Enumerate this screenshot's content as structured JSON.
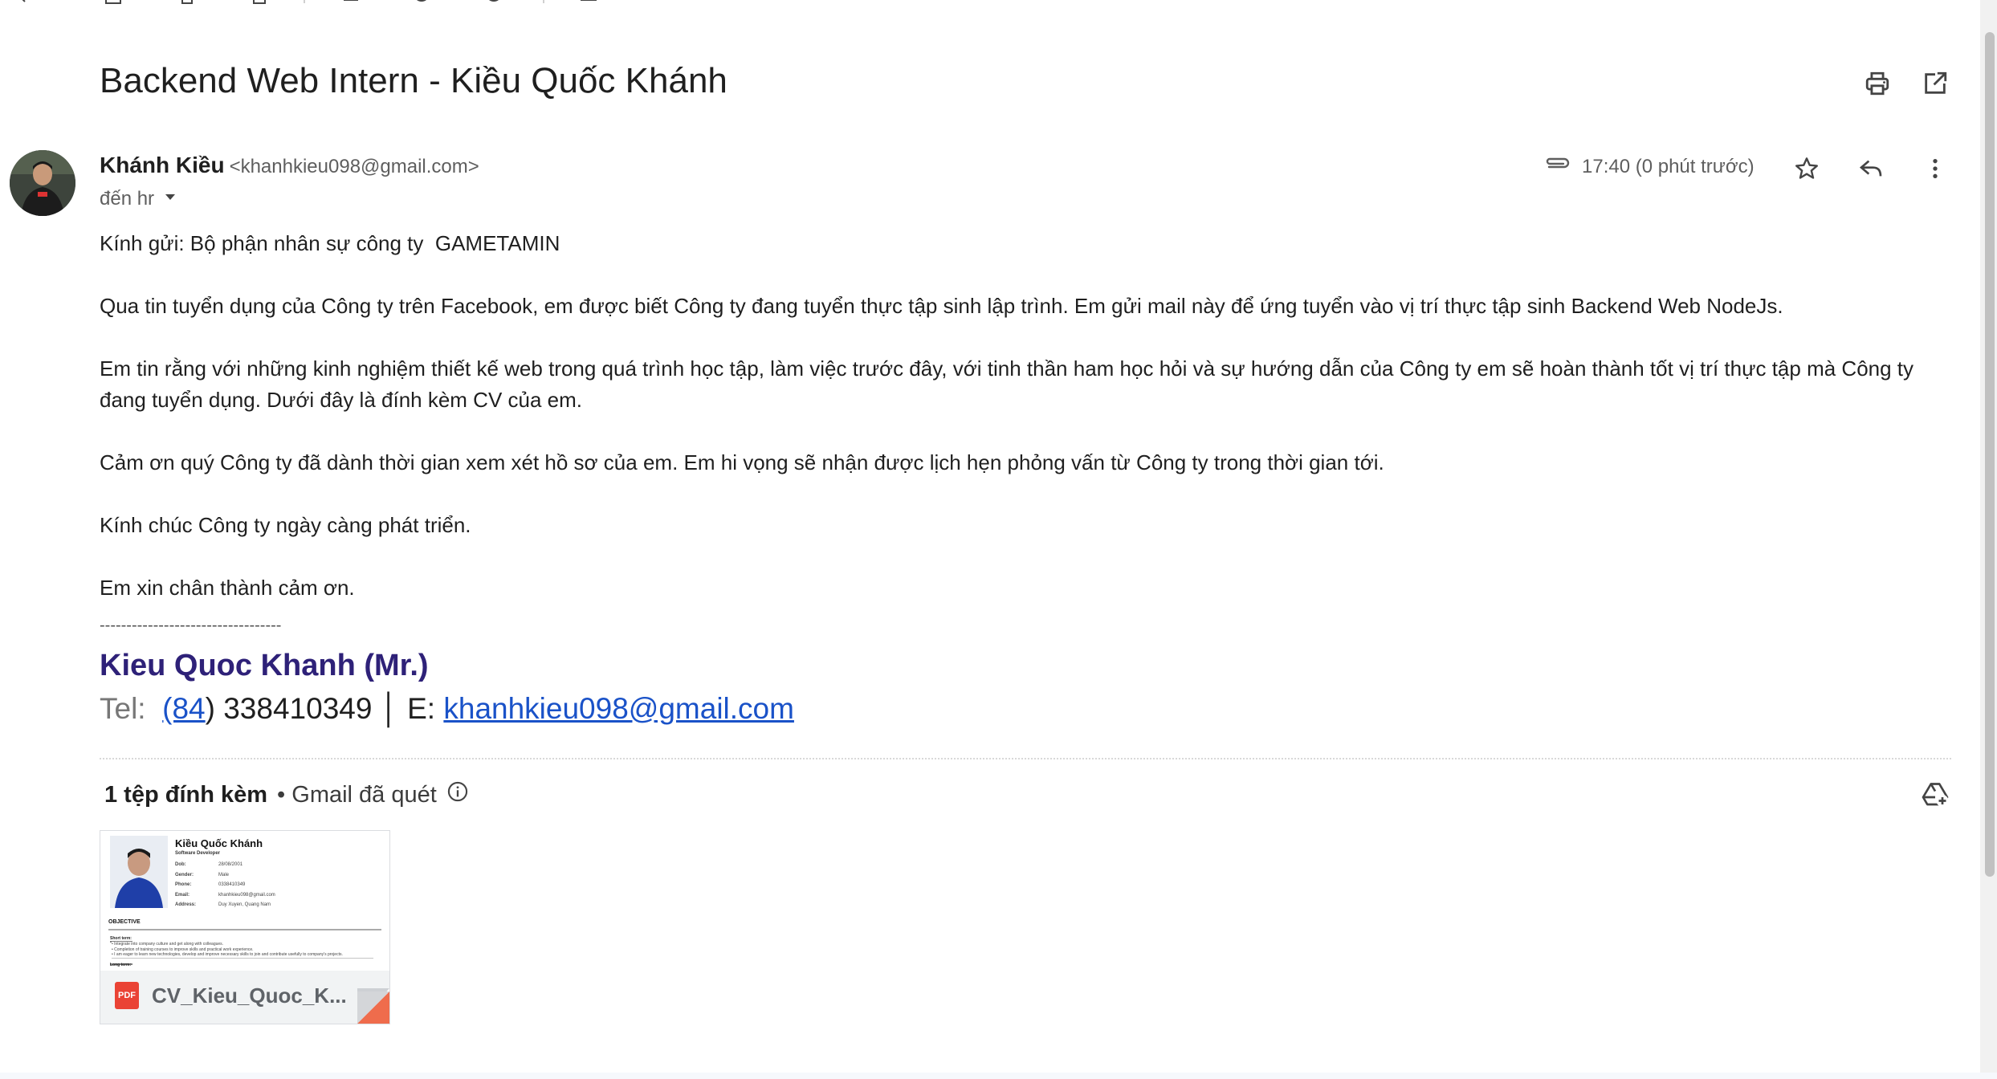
{
  "subject": "Backend Web Intern - Kiều Quốc Khánh",
  "sender": {
    "name": "Khánh Kiều",
    "email": "<khanhkieu098@gmail.com>",
    "to": "đến hr"
  },
  "time": "17:40 (0 phút trước)",
  "body": [
    "Kính gửi: Bộ phận nhân sự công ty  GAMETAMIN",
    "Qua tin tuyển dụng của Công ty trên Facebook, em được biết Công ty đang tuyển thực tập sinh lập trình. Em gửi mail này để ứng tuyển vào vị trí thực tập sinh Backend Web NodeJs.",
    "Em tin rằng với những kinh nghiệm thiết kế web trong quá trình học tập, làm việc trước đây, với tinh thần ham học hỏi và sự hướng dẫn của Công ty em sẽ hoàn thành tốt vị trí thực tập mà Công ty đang tuyển dụng. Dưới đây là đính kèm CV của em.",
    "Cảm ơn quý Công ty đã dành thời gian xem xét hồ sơ của em. Em hi vọng sẽ nhận được lịch hẹn phỏng vấn từ Công ty trong thời gian tới.",
    "Kính chúc Công ty ngày càng phát triển.",
    "Em xin chân thành cảm ơn."
  ],
  "signature": {
    "separator": "----------------------------------",
    "name": "Kieu Quoc Khanh (Mr.)",
    "tel_label": "Tel:",
    "tel_code": "(84",
    "tel_number": ") 338410349",
    "sep": "│",
    "email_label": "E:",
    "email": "khanhkieu098@gmail.com"
  },
  "attachments": {
    "count_label": "1 tệp đính kèm",
    "scan_label": "• Gmail đã quét",
    "file": {
      "badge": "PDF",
      "name": "CV_Kieu_Quoc_K...",
      "preview": {
        "name": "Kiều Quốc Khánh",
        "role": "Software Developer",
        "rows": [
          {
            "k": "Dob:",
            "v": "28/08/2001"
          },
          {
            "k": "Gender:",
            "v": "Male"
          },
          {
            "k": "Phone:",
            "v": "0338410349"
          },
          {
            "k": "Email:",
            "v": "khanhkieu098@gmail.com"
          },
          {
            "k": "Address:",
            "v": "Duy Xuyen, Quang Nam"
          }
        ],
        "section": "OBJECTIVE",
        "short_term": "Short term:",
        "bullets": [
          "• Integrate into company culture and get along with colleagues.",
          "• Completion of training courses to improve skills and practical work experience.",
          "• I am eager to learn new technologies, develop and improve necessary skills to join and contribute usefully to company's projects."
        ],
        "long_term": "Long term:"
      }
    }
  },
  "icons": [
    "print-icon",
    "open-in-new-window-icon",
    "attachment-clip-icon",
    "star-icon",
    "reply-icon",
    "more-vert-icon",
    "dropdown-arrow-icon",
    "info-icon",
    "add-to-drive-icon"
  ]
}
